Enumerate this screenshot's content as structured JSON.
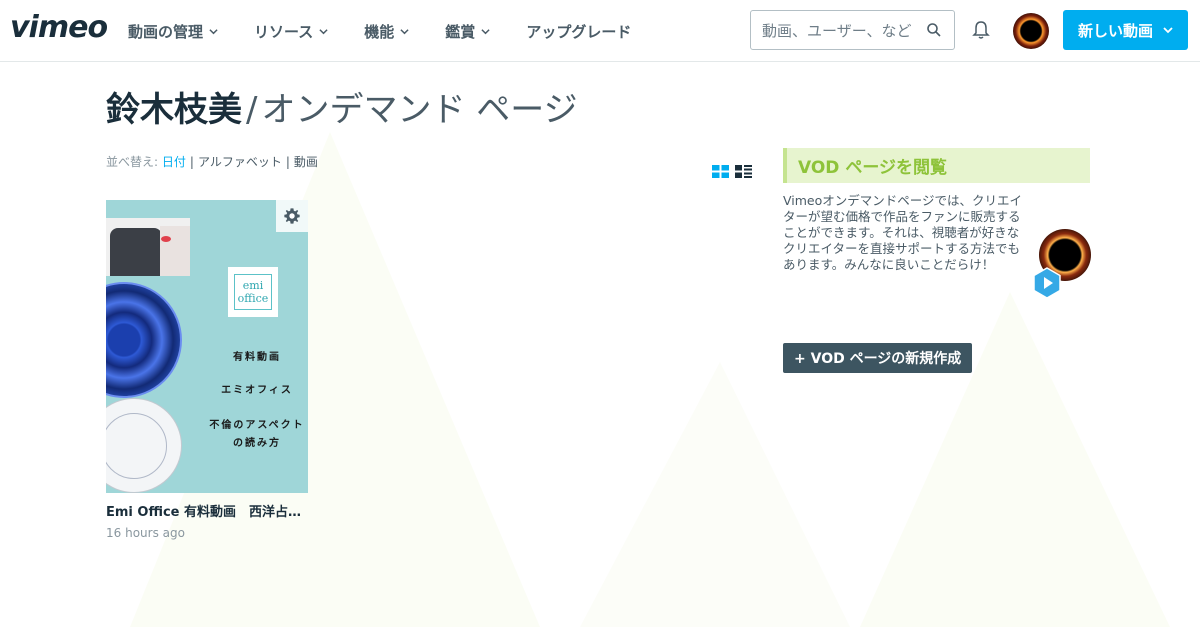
{
  "header": {
    "logo": "vimeo",
    "nav": [
      {
        "label": "動画の管理"
      },
      {
        "label": "リソース"
      },
      {
        "label": "機能"
      },
      {
        "label": "鑑賞"
      },
      {
        "label": "アップグレード"
      }
    ],
    "search_placeholder": "動画、ユーザー、など",
    "new_video_label": "新しい動画"
  },
  "page": {
    "owner": "鈴木枝美",
    "separator": "/",
    "title_suffix": "オンデマンド ページ"
  },
  "sort": {
    "label": "並べ替え:",
    "options": [
      "日付",
      "アルファベット",
      "動画"
    ],
    "active": "日付"
  },
  "videos": [
    {
      "title": "Emi Office 有料動画　西洋占星術",
      "time": "16 hours ago",
      "thumbnail": {
        "logo_text_1": "emi",
        "logo_text_2": "office",
        "lines": [
          "有料動画",
          "エミオフィス",
          "不倫のアスペクト",
          "の読み方"
        ]
      }
    }
  ],
  "vod_panel": {
    "header": "VOD ページを閲覧",
    "description": "Vimeoオンデマンドページでは、クリエイターが望む価格で作品をファンに販売することができます。それは、視聴者が好きなクリエイターを直接サポートする方法でもあります。みんなに良いことだらけ！",
    "create_label": "+ VOD ページの新規作成"
  },
  "colors": {
    "brand_blue": "#00adef",
    "vod_green": "#8ec33a",
    "vod_green_bg": "#e7f4cf",
    "dark_button": "#3d5561"
  }
}
